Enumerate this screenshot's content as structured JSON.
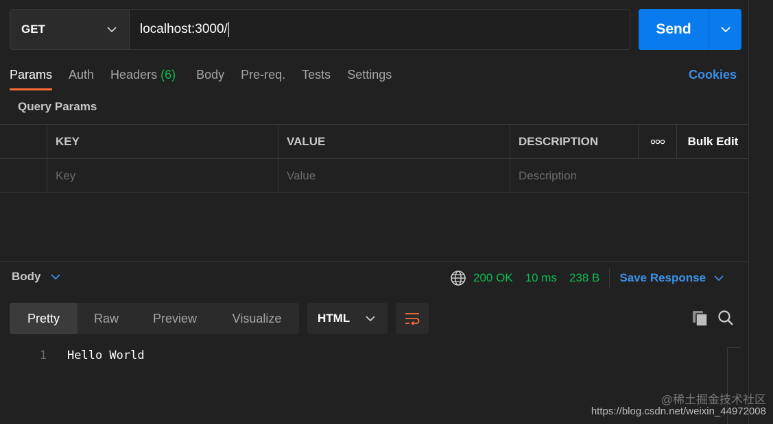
{
  "request": {
    "method": "GET",
    "url": "localhost:3000/",
    "send_label": "Send"
  },
  "request_tabs": [
    {
      "label": "Params",
      "active": true
    },
    {
      "label": "Auth"
    },
    {
      "label": "Headers",
      "badge": "(6)"
    },
    {
      "label": "Body"
    },
    {
      "label": "Pre-req."
    },
    {
      "label": "Tests"
    },
    {
      "label": "Settings"
    }
  ],
  "cookies_label": "Cookies",
  "query_params": {
    "title": "Query Params",
    "headers": {
      "key": "KEY",
      "value": "VALUE",
      "description": "DESCRIPTION",
      "more": "ooo",
      "bulk_edit": "Bulk Edit"
    },
    "placeholders": {
      "key": "Key",
      "value": "Value",
      "description": "Description"
    }
  },
  "response": {
    "body_label": "Body",
    "status": "200 OK",
    "time": "10 ms",
    "size": "238 B",
    "save_label": "Save Response",
    "view_tabs": [
      "Pretty",
      "Raw",
      "Preview",
      "Visualize"
    ],
    "active_view": "Pretty",
    "format": "HTML",
    "lines": [
      {
        "number": "1",
        "text": "Hello World"
      }
    ]
  },
  "watermark": {
    "line1": "@稀土掘金技术社区",
    "line2": "https://blog.csdn.net/weixin_44972008"
  },
  "colors": {
    "accent_blue": "#097bed",
    "tab_underline": "#ff6c37",
    "status_green": "#0cbb52",
    "link_blue": "#3d8fe6"
  }
}
